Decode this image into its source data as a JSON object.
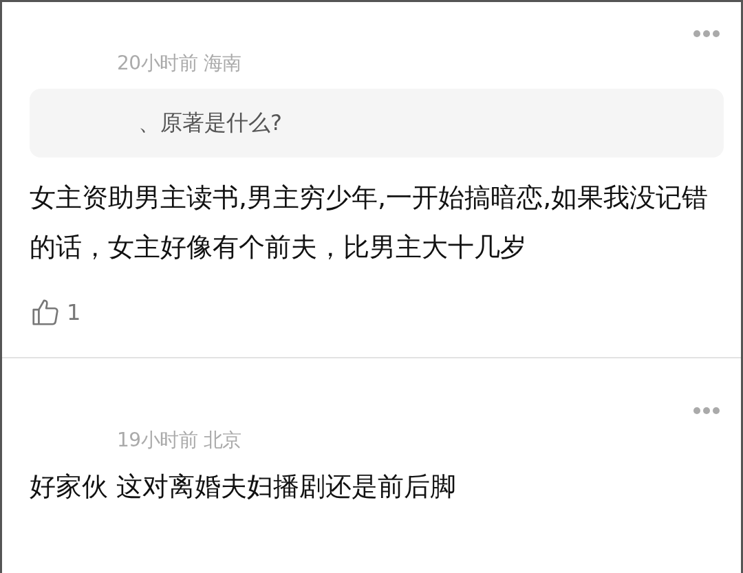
{
  "comments": [
    {
      "time": "20小时前",
      "location": "海南",
      "quote": "、原著是什么?",
      "body": "女主资助男主读书,男主穷少年,一开始搞暗恋,如果我没记错的话，女主好像有个前夫，比男主大十几岁",
      "likes": "1"
    },
    {
      "time": "19小时前",
      "location": "北京",
      "body": "好家伙 这对离婚夫妇播剧还是前后脚"
    }
  ]
}
